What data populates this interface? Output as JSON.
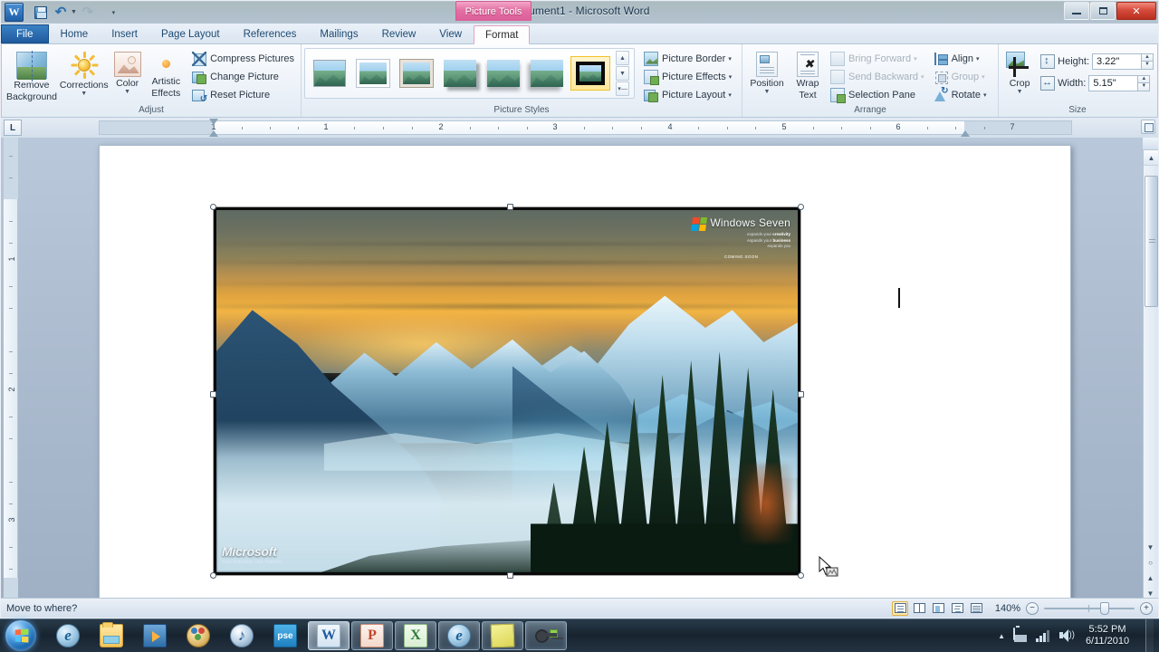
{
  "titlebar": {
    "document_title": "Document1  -  Microsoft Word",
    "contextual_tab_banner": "Picture Tools",
    "qat": [
      {
        "name": "word-logo",
        "label": "W"
      },
      {
        "name": "save",
        "label": "Save"
      },
      {
        "name": "undo",
        "label": "Undo"
      },
      {
        "name": "redo",
        "label": "Redo"
      },
      {
        "name": "customize-qat",
        "label": "Customize Quick Access Toolbar"
      }
    ],
    "window_buttons": {
      "minimize": "Minimize",
      "maximize": "Restore Down",
      "close": "✕"
    }
  },
  "ribbon": {
    "tabs": [
      {
        "label": "File",
        "id": "file"
      },
      {
        "label": "Home",
        "id": "home"
      },
      {
        "label": "Insert",
        "id": "insert"
      },
      {
        "label": "Page Layout",
        "id": "page-layout"
      },
      {
        "label": "References",
        "id": "references"
      },
      {
        "label": "Mailings",
        "id": "mailings"
      },
      {
        "label": "Review",
        "id": "review"
      },
      {
        "label": "View",
        "id": "view"
      },
      {
        "label": "Format",
        "id": "format"
      }
    ],
    "active_tab": "Format",
    "groups": {
      "adjust": {
        "label": "Adjust",
        "remove_background": "Remove\nBackground",
        "remove_background_line1": "Remove",
        "remove_background_line2": "Background",
        "corrections": "Corrections",
        "color": "Color",
        "artistic_effects_line1": "Artistic",
        "artistic_effects_line2": "Effects",
        "compress_pictures": "Compress Pictures",
        "change_picture": "Change Picture",
        "reset_picture": "Reset Picture"
      },
      "picture_styles": {
        "label": "Picture Styles",
        "selected_style_index": 6,
        "styles": [
          "Simple Frame, White",
          "Beveled Matte, White",
          "Metal Frame",
          "Drop Shadow Rectangle",
          "Reflected Rounded Rectangle",
          "Soft Edge Rectangle",
          "Simple Frame, Black"
        ],
        "picture_border": "Picture Border",
        "picture_effects": "Picture Effects",
        "picture_layout": "Picture Layout"
      },
      "arrange": {
        "label": "Arrange",
        "position": "Position",
        "wrap_text_line1": "Wrap",
        "wrap_text_line2": "Text",
        "bring_forward": "Bring Forward",
        "send_backward": "Send Backward",
        "selection_pane": "Selection Pane",
        "align": "Align",
        "group": "Group",
        "rotate": "Rotate",
        "disabled": [
          "Bring Forward",
          "Send Backward",
          "Group"
        ]
      },
      "size": {
        "label": "Size",
        "crop": "Crop",
        "height_label": "Height:",
        "height_value": "3.22\"",
        "width_label": "Width:",
        "width_value": "5.15\""
      }
    }
  },
  "ruler": {
    "tab_stop_marker": "L",
    "horizontal_numbers": [
      "1",
      "1",
      "2",
      "3",
      "4",
      "5",
      "6",
      "7"
    ],
    "vertical_numbers": [
      "1",
      "2",
      "3"
    ],
    "unit": "inches"
  },
  "document": {
    "picture": {
      "alt": "Windows Seven mountain sunset wallpaper",
      "selected": true,
      "win7_title": "Windows Seven",
      "win7_trademark": "®",
      "win7_tagline_1_pre": "expands your ",
      "win7_tagline_1_bold": "creativity",
      "win7_tagline_2_pre": "expands your ",
      "win7_tagline_2_bold": "business",
      "win7_tagline_3": "expands you",
      "win7_coming_soon": "COMING SOON",
      "microsoft_name": "Microsoft",
      "microsoft_tagline": "Your Potential. Our Passion."
    }
  },
  "statusbar": {
    "message": "Move to where?",
    "views": [
      {
        "name": "print-layout",
        "label": "Print Layout",
        "active": true
      },
      {
        "name": "full-screen-reading",
        "label": "Full Screen Reading",
        "active": false
      },
      {
        "name": "web-layout",
        "label": "Web Layout",
        "active": false
      },
      {
        "name": "outline",
        "label": "Outline",
        "active": false
      },
      {
        "name": "draft",
        "label": "Draft",
        "active": false
      }
    ],
    "zoom_percent": "140%",
    "zoom_out": "−",
    "zoom_in": "+"
  },
  "taskbar": {
    "start": "Start",
    "items": [
      {
        "name": "internet-explorer",
        "label": "Internet Explorer",
        "state": "pinned"
      },
      {
        "name": "windows-explorer",
        "label": "Windows Explorer",
        "state": "pinned"
      },
      {
        "name": "windows-media-player",
        "label": "Windows Media Player",
        "state": "pinned"
      },
      {
        "name": "windows-live-messenger",
        "label": "Windows Live Messenger",
        "state": "pinned"
      },
      {
        "name": "itunes",
        "label": "iTunes",
        "state": "pinned"
      },
      {
        "name": "photoshop-elements",
        "label": "Photoshop Elements",
        "state": "pinned"
      },
      {
        "name": "microsoft-word",
        "label": "Microsoft Word - Document1",
        "state": "active"
      },
      {
        "name": "microsoft-powerpoint",
        "label": "Microsoft PowerPoint",
        "state": "open"
      },
      {
        "name": "microsoft-excel",
        "label": "Microsoft Excel",
        "state": "open"
      },
      {
        "name": "internet-explorer-window",
        "label": "Internet Explorer",
        "state": "open"
      },
      {
        "name": "sticky-notes",
        "label": "Sticky Notes",
        "state": "open"
      },
      {
        "name": "keygen-tool",
        "label": "Key Tool",
        "state": "open"
      }
    ],
    "tray": {
      "show_hidden": "Show hidden icons",
      "battery": "Battery",
      "network": "Network",
      "volume": "Volume",
      "time": "5:52 PM",
      "date": "6/11/2010"
    }
  },
  "colors": {
    "file_tab": "#1f5b9e",
    "contextual_pink": "#dd5e99",
    "ribbon_bg": "#eef3f9",
    "selection_black": "#0a0a0a",
    "accent_orange": "#f2b544"
  }
}
